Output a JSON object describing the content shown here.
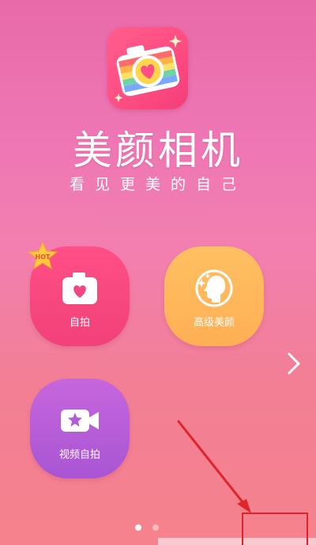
{
  "app": {
    "title": "美颜相机",
    "subtitle": "看见更美的自己"
  },
  "tiles": [
    {
      "label": "自拍",
      "icon": "camera-heart-icon",
      "badge": "HOT"
    },
    {
      "label": "高级美颜",
      "icon": "face-profile-sparkle-icon"
    },
    {
      "label": "视频自拍",
      "icon": "video-camera-star-icon"
    }
  ],
  "pager": {
    "pages": 2,
    "current": 1
  },
  "colors": {
    "selfie_tile": "#f2467e",
    "beauty_tile": "#ffb45a",
    "video_tile": "#b45bd8",
    "annotation_red": "#e0242a"
  }
}
